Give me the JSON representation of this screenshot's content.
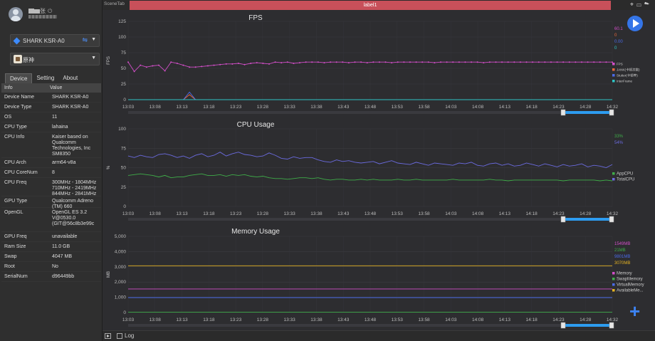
{
  "user": {
    "name": "▇▆张"
  },
  "device_selector": {
    "label": "SHARK KSR-A0"
  },
  "app_selector": {
    "label": "原神"
  },
  "tabs": [
    "Device",
    "Setting",
    "About"
  ],
  "info_table": {
    "headers": [
      "Info",
      "Value"
    ],
    "rows": [
      {
        "k": "Device Name",
        "v": "SHARK KSR-A0"
      },
      {
        "k": "Device Type",
        "v": "SHARK KSR-A0"
      },
      {
        "k": "OS",
        "v": "11"
      },
      {
        "k": "CPU Type",
        "v": "lahaina"
      },
      {
        "k": "CPU Info",
        "v": "Kaiser based on Qualcomm Technologies, Inc SM8350"
      },
      {
        "k": "CPU Arch",
        "v": "arm64-v8a"
      },
      {
        "k": "CPU CoreNum",
        "v": "8"
      },
      {
        "k": "CPU Freq",
        "v": "300MHz - 1804MHz 710MHz - 2419MHz 844MHz - 2841MHz"
      },
      {
        "k": "GPU Type",
        "v": "Qualcomm Adreno (TM) 660"
      },
      {
        "k": "OpenGL",
        "v": "OpenGL ES 3.2 V@0530.0 (GIT@56c8b3e99c"
      },
      {
        "k": "GPU Freq",
        "v": "unavailable"
      },
      {
        "k": "Ram Size",
        "v": "11.0 GB"
      },
      {
        "k": "Swap",
        "v": "4047 MB"
      },
      {
        "k": "Root",
        "v": "No"
      },
      {
        "k": "SerialNum",
        "v": "d96449bb"
      }
    ]
  },
  "topbar": {
    "scene_tab": "SceneTab",
    "label": "label1"
  },
  "bottombar": {
    "log_label": "Log"
  },
  "colors": {
    "accent": "#3575e8",
    "label_bar": "#c8505a",
    "fps": "#d24ec8",
    "cpu_total": "#6b6be0",
    "cpu_app": "#3fae49",
    "mem": "#d24ec8",
    "mem_swap": "#3fae49",
    "mem_virtual": "#4a6ae8",
    "mem_avail": "#e6b422",
    "interframe": "#2ec4c4"
  },
  "chart_data": [
    {
      "type": "line",
      "title": "FPS",
      "ylabel": "FPS",
      "ylim": [
        0,
        125
      ],
      "yticks": [
        0,
        25,
        50,
        75,
        100,
        125
      ],
      "x": [
        "13:03",
        "13:08",
        "13:13",
        "13:18",
        "13:23",
        "13:28",
        "13:33",
        "13:38",
        "13:43",
        "13:48",
        "13:53",
        "13:58",
        "14:03",
        "14:08",
        "14:13",
        "14:18",
        "14:23",
        "14:28",
        "14:32"
      ],
      "series": [
        {
          "name": "FPS",
          "color": "#d24ec8",
          "values": [
            60,
            45,
            55,
            52,
            54,
            55,
            46,
            60,
            58,
            55,
            52,
            52,
            53,
            54,
            55,
            56,
            57,
            57,
            58,
            56,
            58,
            59,
            58,
            57,
            60,
            59,
            60,
            58,
            59,
            60,
            60,
            60,
            59,
            60,
            60,
            60,
            59,
            60,
            60,
            59,
            60,
            60,
            60,
            59,
            60,
            60,
            60,
            60,
            60,
            60,
            59,
            60,
            60,
            60,
            60,
            60,
            60,
            60,
            59,
            60,
            60,
            60,
            60,
            60,
            60,
            60,
            60,
            60,
            60,
            60,
            60,
            60,
            60,
            60,
            60,
            60,
            60,
            60,
            60,
            60
          ]
        },
        {
          "name": "JANK(卡顿次数)",
          "color": "#e8663a",
          "values": [
            0,
            0,
            0,
            0,
            0,
            0,
            0,
            0,
            0,
            0,
            8,
            0,
            0,
            0,
            0,
            0,
            0,
            0,
            0,
            0,
            0,
            0,
            0,
            0,
            0,
            0,
            0,
            0,
            0,
            0,
            0,
            0,
            0,
            0,
            0,
            0,
            0,
            0,
            0,
            0,
            0,
            0,
            0,
            0,
            0,
            0,
            0,
            0,
            0,
            0,
            0,
            0,
            0,
            0,
            0,
            0,
            0,
            0,
            0,
            0,
            0,
            0,
            0,
            0,
            0,
            0,
            0,
            0,
            0,
            0,
            0,
            0,
            0,
            0,
            0,
            0,
            0,
            0,
            0,
            0
          ]
        },
        {
          "name": "Stutter(卡顿率)",
          "color": "#4a6ae8",
          "values": [
            0,
            0,
            0,
            0,
            0,
            0,
            0,
            0,
            0,
            0,
            12,
            0,
            0,
            0,
            0,
            0,
            0,
            0,
            0,
            0,
            0,
            0,
            0,
            0,
            0,
            0,
            0,
            0,
            0,
            0,
            0,
            0,
            0,
            0,
            0,
            0,
            0,
            0,
            0,
            0,
            0,
            0,
            0,
            0,
            0,
            0,
            0,
            0,
            0,
            0,
            0,
            0,
            0,
            0,
            0,
            0,
            0,
            0,
            0,
            0,
            0,
            0,
            0,
            0,
            0,
            0,
            0,
            0,
            0,
            0,
            0,
            0,
            0,
            0,
            0,
            0,
            0,
            0,
            0,
            0
          ]
        },
        {
          "name": "InterFrame",
          "color": "#2ec4c4",
          "values": [
            0,
            0,
            0,
            0,
            0,
            0,
            0,
            0,
            0,
            0,
            0,
            0,
            0,
            0,
            0,
            0,
            0,
            0,
            0,
            0,
            0,
            0,
            0,
            0,
            0,
            0,
            0,
            0,
            0,
            0,
            0,
            0,
            0,
            0,
            0,
            0,
            0,
            0,
            0,
            0,
            0,
            0,
            0,
            0,
            0,
            0,
            0,
            0,
            0,
            0,
            0,
            0,
            0,
            0,
            0,
            0,
            0,
            0,
            0,
            0,
            0,
            0,
            0,
            0,
            0,
            0,
            0,
            0,
            0,
            0,
            0,
            0,
            0,
            0,
            0,
            0,
            0,
            0,
            0,
            0
          ]
        }
      ],
      "current_values": [
        "60.1",
        "0",
        "0.00",
        "0"
      ]
    },
    {
      "type": "line",
      "title": "CPU Usage",
      "ylabel": "%",
      "ylim": [
        0,
        100
      ],
      "yticks": [
        0,
        25,
        50,
        75,
        100
      ],
      "x": [
        "13:03",
        "13:08",
        "13:13",
        "13:18",
        "13:23",
        "13:28",
        "13:33",
        "13:38",
        "13:43",
        "13:48",
        "13:53",
        "13:58",
        "14:03",
        "14:08",
        "14:13",
        "14:18",
        "14:23",
        "14:28",
        "14:32"
      ],
      "series": [
        {
          "name": "AppCPU",
          "color": "#3fae49",
          "values": [
            40,
            41,
            42,
            41,
            40,
            38,
            40,
            37,
            38,
            38,
            40,
            41,
            42,
            40,
            40,
            41,
            39,
            41,
            40,
            41,
            39,
            38,
            39,
            37,
            36,
            36,
            35,
            36,
            37,
            37,
            36,
            37,
            35,
            34,
            35,
            35,
            34,
            34,
            35,
            34,
            35,
            34,
            34,
            34,
            35,
            34,
            34,
            35,
            34,
            34,
            34,
            34,
            34,
            35,
            34,
            34,
            34,
            34,
            34,
            35,
            34,
            34,
            33,
            34,
            34,
            34,
            34,
            34,
            34,
            34,
            34,
            33,
            34,
            34,
            34,
            34,
            34,
            33,
            34,
            33
          ]
        },
        {
          "name": "TotalCPU",
          "color": "#6b6be0",
          "values": [
            65,
            63,
            66,
            64,
            63,
            67,
            68,
            66,
            63,
            65,
            62,
            66,
            68,
            64,
            66,
            70,
            65,
            68,
            70,
            67,
            66,
            64,
            65,
            69,
            66,
            62,
            61,
            64,
            62,
            63,
            63,
            60,
            58,
            57,
            60,
            58,
            59,
            57,
            56,
            57,
            58,
            55,
            57,
            59,
            56,
            55,
            54,
            57,
            55,
            53,
            56,
            55,
            54,
            53,
            56,
            55,
            57,
            53,
            52,
            55,
            56,
            53,
            55,
            52,
            53,
            56,
            54,
            52,
            55,
            53,
            51,
            54,
            52,
            53,
            55,
            51,
            53,
            52,
            50,
            54
          ]
        }
      ],
      "current_values": [
        "33%",
        "54%"
      ]
    },
    {
      "type": "line",
      "title": "Memory Usage",
      "ylabel": "MB",
      "ylim": [
        0,
        5000
      ],
      "yticks": [
        0,
        1000,
        2000,
        3000,
        4000,
        5000
      ],
      "ytick_labels": [
        "0",
        "1,000",
        "2,000",
        "3,000",
        "4,000",
        "5,000"
      ],
      "x": [
        "13:03",
        "13:08",
        "13:13",
        "13:18",
        "13:23",
        "13:28",
        "13:33",
        "13:38",
        "13:43",
        "13:48",
        "13:53",
        "13:58",
        "14:03",
        "14:08",
        "14:13",
        "14:18",
        "14:23",
        "14:28",
        "14:32"
      ],
      "series": [
        {
          "name": "Memory",
          "color": "#d24ec8",
          "values": [
            1549,
            1549
          ]
        },
        {
          "name": "SwapMemory",
          "color": "#3fae49",
          "values": [
            21,
            21
          ]
        },
        {
          "name": "VirtualMemory",
          "color": "#4a6ae8",
          "values": [
            980,
            980
          ]
        },
        {
          "name": "AvailableMe...",
          "color": "#e6b422",
          "values": [
            3070,
            3070
          ]
        }
      ],
      "current_values": [
        "1549MB",
        "21MB",
        "9801MB",
        "3070MB"
      ]
    }
  ]
}
